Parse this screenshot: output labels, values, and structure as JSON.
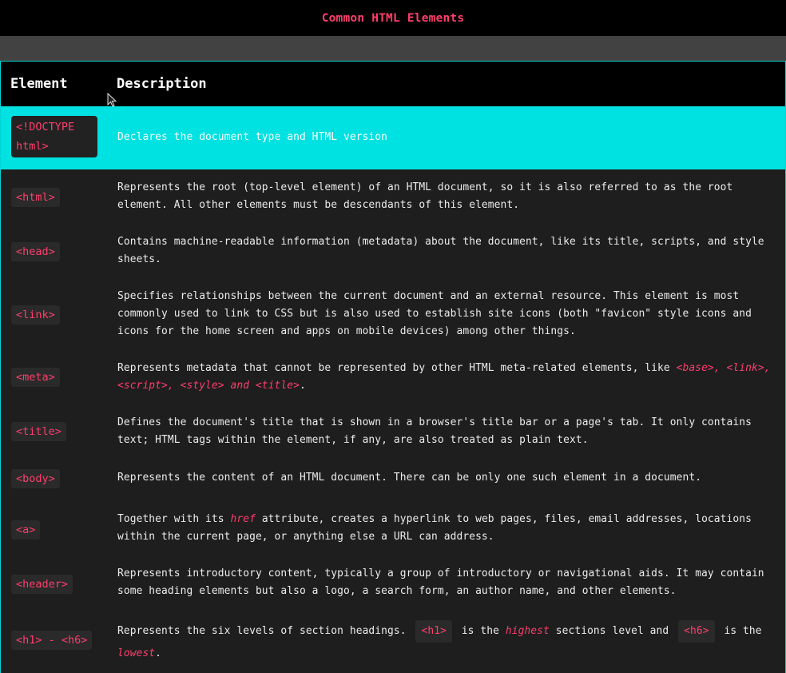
{
  "page": {
    "title": "Common HTML Elements"
  },
  "table": {
    "headers": {
      "element": "Element",
      "description": "Description"
    },
    "rows": [
      {
        "tag_line1": "<!DOCTYPE",
        "tag_line2": "html>",
        "description": "Declares the document type and HTML version"
      },
      {
        "tag": "<html>",
        "description": "Represents the root (top-level element) of an HTML document, so it is also referred to as the root element. All other elements must be descendants of this element."
      },
      {
        "tag": "<head>",
        "description": "Contains machine-readable information (metadata) about the document, like its title, scripts, and style sheets."
      },
      {
        "tag": "<link>",
        "description": "Specifies relationships between the current document and an external resource. This element is most commonly used to link to CSS but is also used to establish site icons (both \"favicon\" style icons and icons for the home screen and apps on mobile devices) among other things."
      },
      {
        "tag": "<meta>",
        "description_prefix": "Represents metadata that cannot be represented by other HTML meta-related elements, like ",
        "description_em": "<base>, <link>, <script>, <style> and <title>",
        "description_suffix": "."
      },
      {
        "tag": "<title>",
        "description": "Defines the document's title that is shown in a browser's title bar or a page's tab. It only contains text; HTML tags within the element, if any, are also treated as plain text."
      },
      {
        "tag": "<body>",
        "description": "Represents the content of an HTML document. There can be only one such element in a document."
      },
      {
        "tag": "<a>",
        "description_prefix": "Together with its ",
        "description_em": "href",
        "description_suffix": " attribute, creates a hyperlink to web pages, files, email addresses, locations within the current page, or anything else a URL can address."
      },
      {
        "tag": "<header>",
        "description": "Represents introductory content, typically a group of introductory or navigational aids. It may contain some heading elements but also a logo, a search form, an author name, and other elements."
      },
      {
        "tag": "<h1> - <h6>",
        "description_part1": "Represents the six levels of section headings.",
        "code1": "<h1>",
        "description_part2": "is the",
        "em1": "highest",
        "description_part3": "sections level and",
        "code2": "<h6>",
        "description_part4": "is the",
        "em2": "lowest",
        "description_part5": "."
      }
    ]
  },
  "colors": {
    "accent": "#ff3e6c",
    "highlight_row": "#00e1e1",
    "border": "#00d4d4",
    "header_bg": "#000000",
    "body_bg": "#1e1e1e",
    "tag_bg": "#2a2a2a"
  },
  "cursor": {
    "icon": "mouse-pointer-icon"
  }
}
